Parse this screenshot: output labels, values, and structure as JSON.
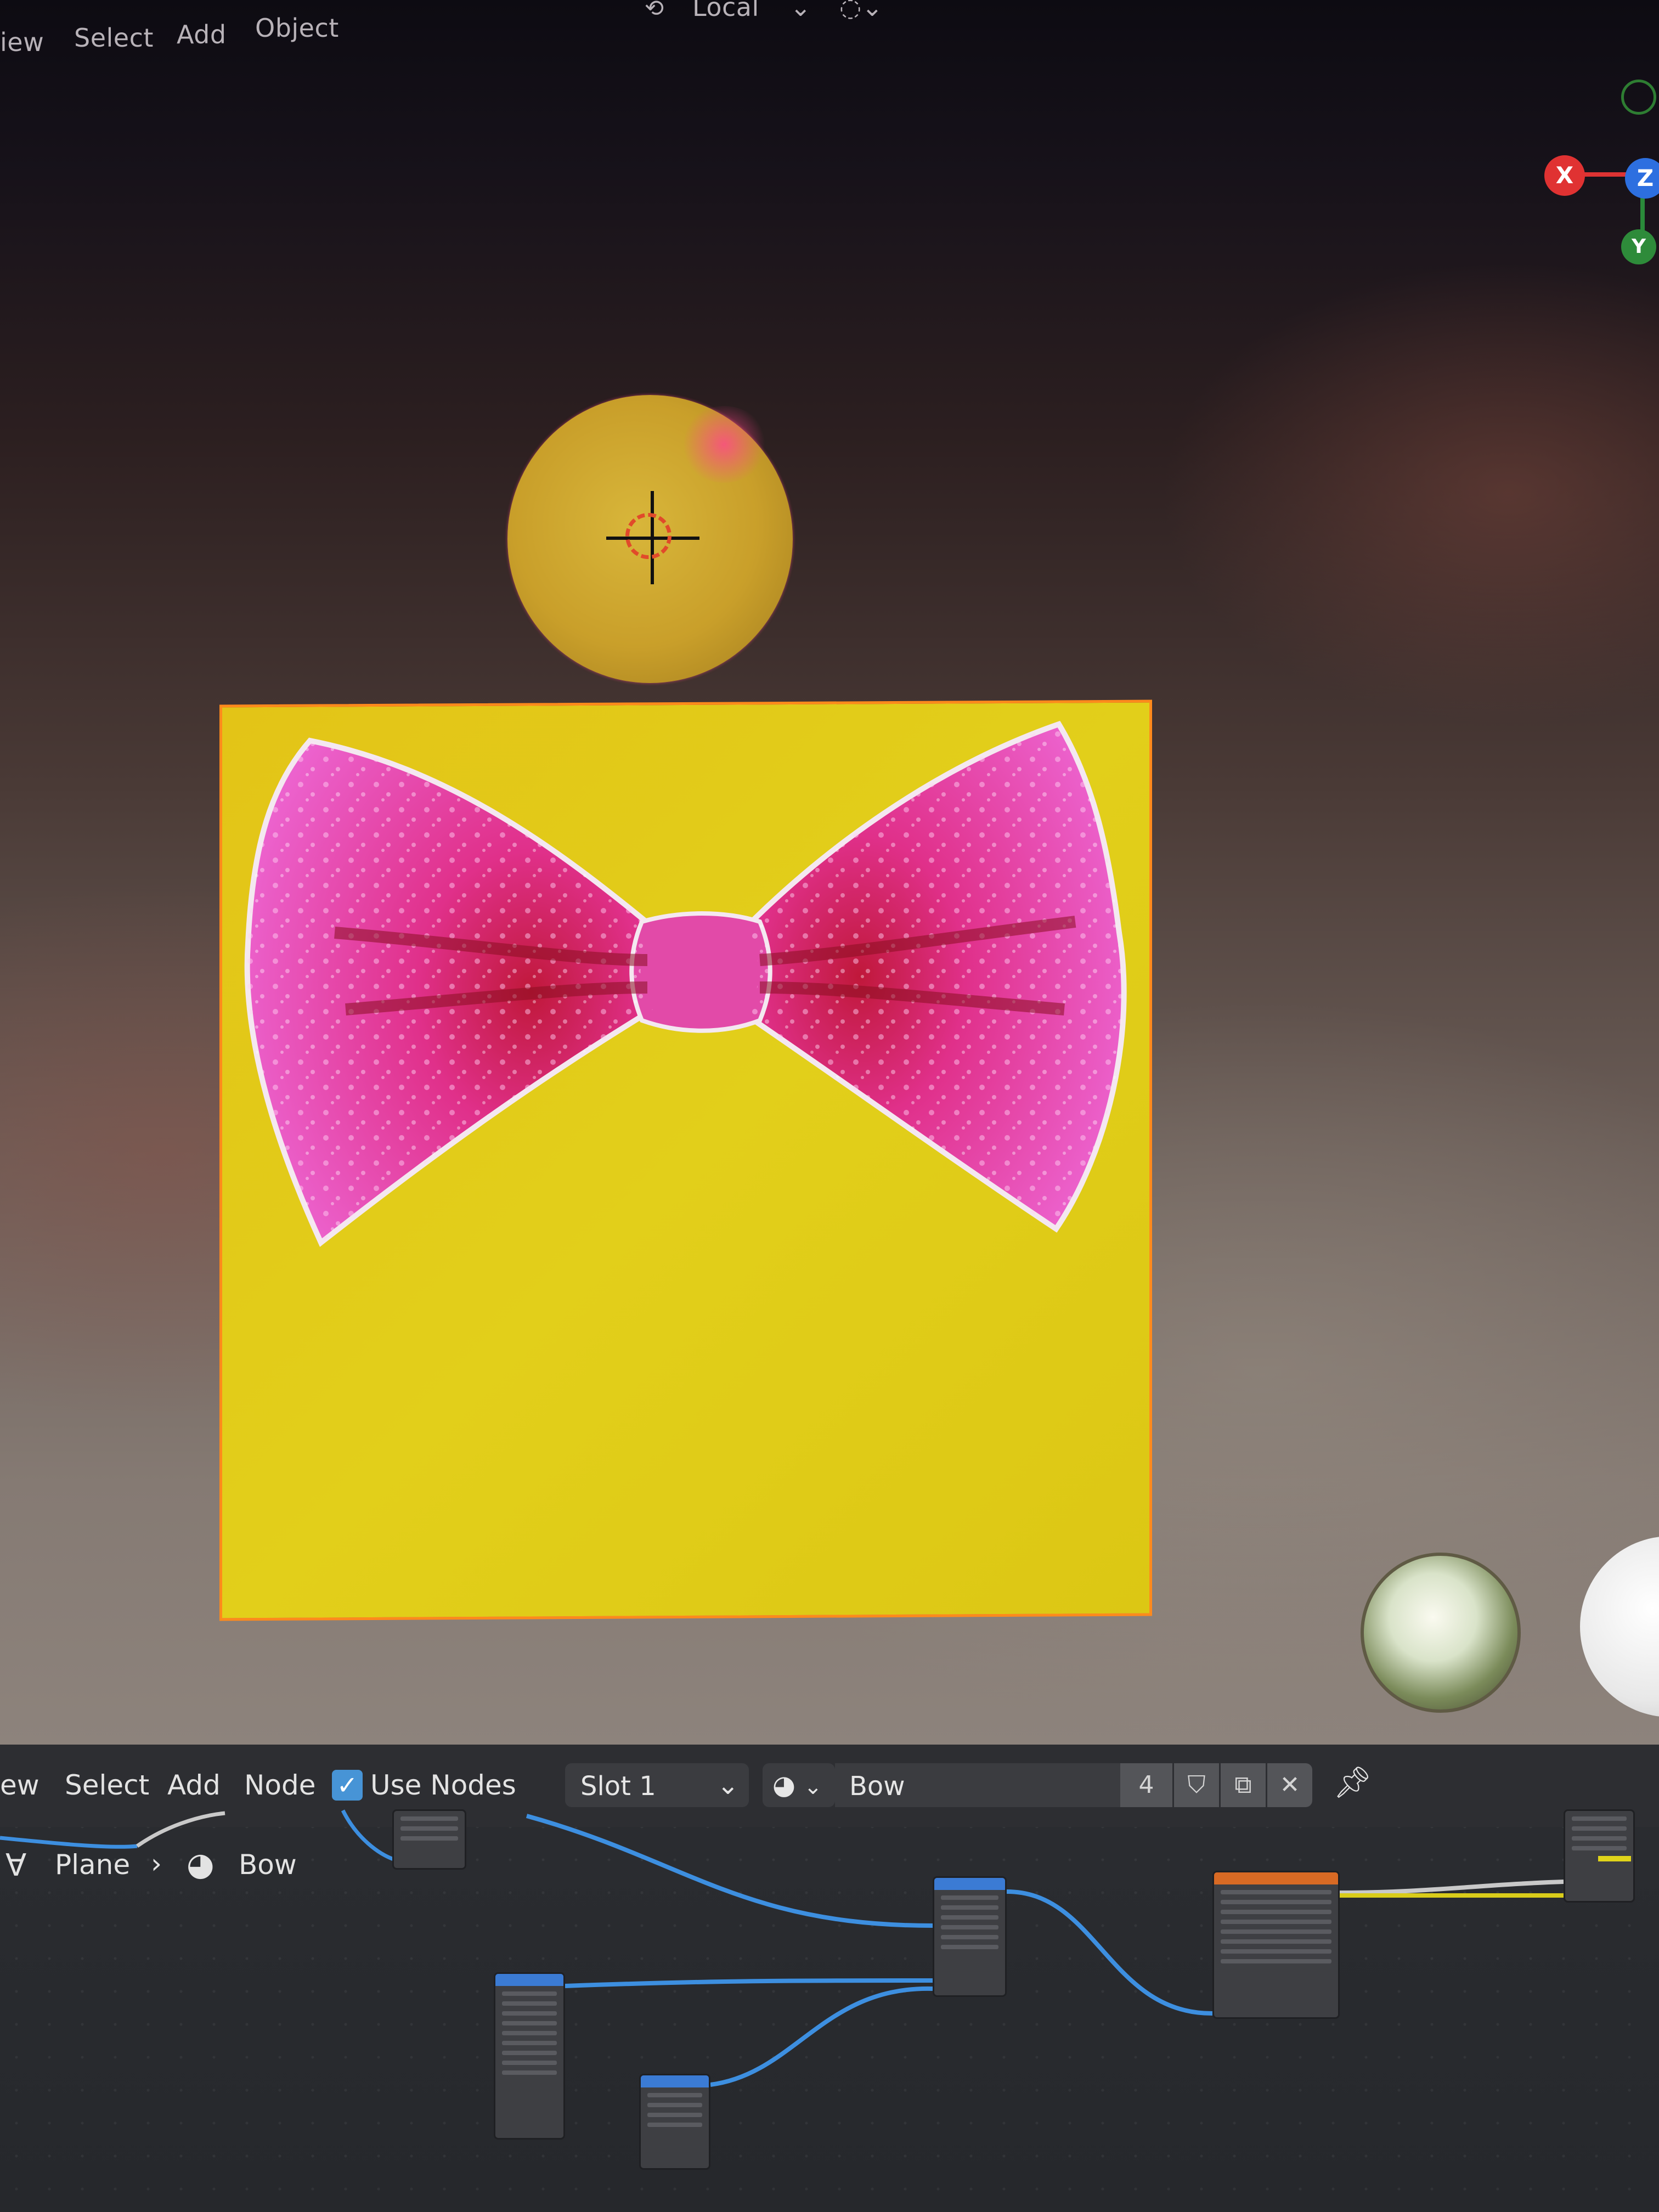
{
  "viewport": {
    "menu": [
      "iew",
      "Select",
      "Add",
      "Object"
    ],
    "header_center": "Local",
    "gizmo": {
      "x": "X",
      "z": "Z",
      "y": "Y"
    },
    "colors": {
      "plane": "#e2cf1a",
      "outline": "#ff8a1c",
      "sphere": "#c99f2a",
      "bow": "#e85ad0"
    }
  },
  "node_editor": {
    "menu": [
      "ew",
      "Select",
      "Add",
      "Node"
    ],
    "use_nodes": {
      "label": "Use Nodes",
      "checked": true
    },
    "slot": "Slot 1",
    "material_name": "Bow",
    "user_count": "4",
    "breadcrumb": {
      "object": "Plane",
      "material": "Bow"
    }
  }
}
